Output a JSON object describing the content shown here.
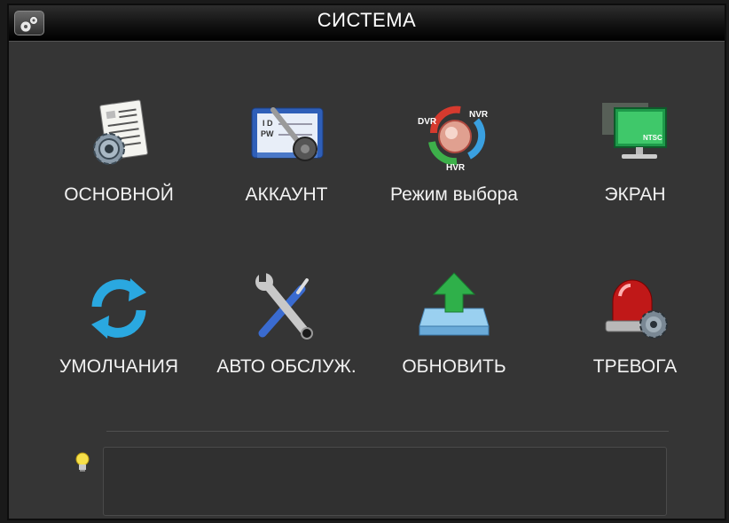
{
  "window": {
    "title": "СИСТЕМА",
    "title_icon": "gears-icon"
  },
  "menu": [
    {
      "label": "ОСНОВНОЙ",
      "icon": "general-settings-icon"
    },
    {
      "label": "АККАУНТ",
      "icon": "account-icon"
    },
    {
      "label": "Режим выбора",
      "icon": "mode-select-icon",
      "icon_text": [
        "DVR",
        "NVR",
        "HVR"
      ]
    },
    {
      "label": "ЭКРАН",
      "icon": "display-icon",
      "icon_text": [
        "NTSC"
      ]
    },
    {
      "label": "УМОЛЧАНИЯ",
      "icon": "refresh-icon"
    },
    {
      "label": "АВТО ОБСЛУЖ.",
      "icon": "tools-icon"
    },
    {
      "label": "ОБНОВИТЬ",
      "icon": "upgrade-icon"
    },
    {
      "label": "ТРЕВОГА",
      "icon": "alarm-icon"
    }
  ],
  "hint": {
    "icon": "lightbulb-icon",
    "text": ""
  }
}
